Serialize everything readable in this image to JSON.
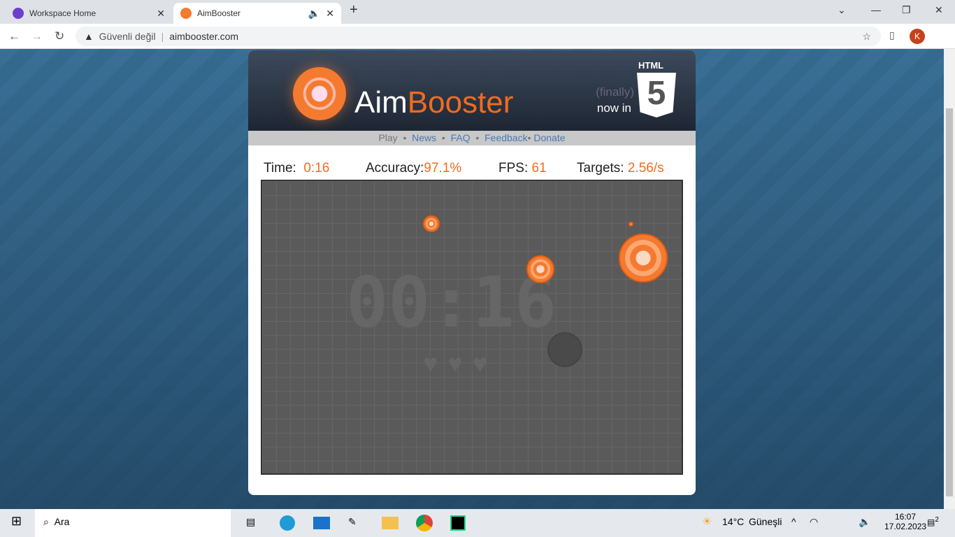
{
  "browser": {
    "tabs": [
      {
        "title": "Workspace Home",
        "active": false
      },
      {
        "title": "AimBooster",
        "active": true
      }
    ],
    "security": "Güvenli değil",
    "url": "aimbooster.com",
    "profile_initial": "K"
  },
  "site": {
    "logo_aim": "Aim",
    "logo_booster": "Booster",
    "html5_top": "HTML",
    "html5_num": "5",
    "finally": "(finally)",
    "now_in": "now in",
    "nav": [
      "Play",
      "News",
      "FAQ",
      "Feedback",
      "Donate"
    ],
    "stats": {
      "time_label": "Time:",
      "time": "0:16",
      "accuracy_label": "Accuracy:",
      "accuracy": "97.1%",
      "fps_label": "FPS:",
      "fps": "61",
      "targets_label": "Targets:",
      "targets": "2.56/s"
    },
    "arena_clock": "00:16",
    "lives": "♥♥♥",
    "accent": "#f26b1d"
  },
  "taskbar": {
    "search": "Ara",
    "weather": "14°C",
    "weather_text": "Güneşli",
    "time": "16:07",
    "date": "17.02.2023",
    "notifications": "2"
  }
}
